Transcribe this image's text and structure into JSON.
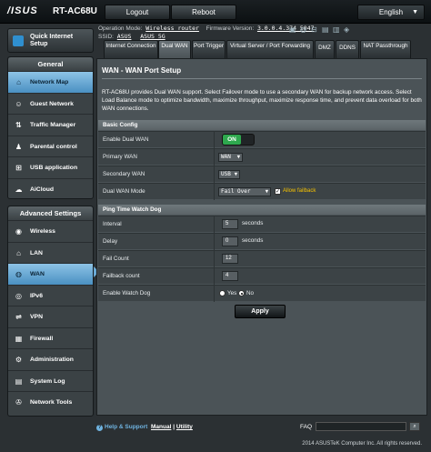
{
  "header": {
    "brand": "/ISUS",
    "model": "RT-AC68U",
    "logout_label": "Logout",
    "reboot_label": "Reboot",
    "language": "English"
  },
  "info": {
    "op_mode_label": "Operation Mode:",
    "op_mode_value": "Wireless router",
    "firmware_label": "Firmware Version:",
    "firmware_value": "3.0.0.4.374_5047",
    "ssid_label": "SSID:",
    "ssid_1": "ASUS",
    "ssid_2": "ASUS_5G"
  },
  "sidebar": {
    "quick_setup": "Quick Internet Setup",
    "general_title": "General",
    "general": [
      {
        "label": "Network Map",
        "icon": "network-map-icon"
      },
      {
        "label": "Guest Network",
        "icon": "guest-network-icon"
      },
      {
        "label": "Traffic Manager",
        "icon": "traffic-manager-icon"
      },
      {
        "label": "Parental control",
        "icon": "parental-control-icon"
      },
      {
        "label": "USB application",
        "icon": "usb-icon"
      },
      {
        "label": "AiCloud",
        "icon": "cloud-icon"
      }
    ],
    "advanced_title": "Advanced Settings",
    "advanced": [
      {
        "label": "Wireless",
        "icon": "wireless-icon"
      },
      {
        "label": "LAN",
        "icon": "lan-icon"
      },
      {
        "label": "WAN",
        "icon": "globe-icon"
      },
      {
        "label": "IPv6",
        "icon": "ipv6-icon"
      },
      {
        "label": "VPN",
        "icon": "vpn-icon"
      },
      {
        "label": "Firewall",
        "icon": "firewall-icon"
      },
      {
        "label": "Administration",
        "icon": "administration-icon"
      },
      {
        "label": "System Log",
        "icon": "system-log-icon"
      },
      {
        "label": "Network Tools",
        "icon": "network-tools-icon"
      }
    ]
  },
  "tabs": [
    {
      "label": "Internet Connection"
    },
    {
      "label": "Dual WAN"
    },
    {
      "label": "Port Trigger"
    },
    {
      "label": "Virtual Server / Port Forwarding"
    },
    {
      "label": "DMZ"
    },
    {
      "label": "DDNS"
    },
    {
      "label": "NAT Passthrough"
    }
  ],
  "main": {
    "title": "WAN - WAN Port Setup",
    "description": "RT-AC68U provides Dual WAN support. Select Failover mode to use a secondary WAN for backup network access. Select Load Balance mode to optimize bandwidth, maximize throughput, maximize response time, and prevent data overload for both WAN connections.",
    "basic_config_title": "Basic Config",
    "enable_dual_wan_label": "Enable Dual WAN",
    "enable_dual_wan_value": "ON",
    "primary_wan_label": "Primary WAN",
    "primary_wan_value": "WAN",
    "secondary_wan_label": "Secondary WAN",
    "secondary_wan_value": "USB",
    "dual_wan_mode_label": "Dual WAN Mode",
    "dual_wan_mode_value": "Fail Over",
    "allow_failback_label": "Allow failback",
    "ping_title": "Ping Time Watch Dog",
    "interval_label": "Interval",
    "interval_value": "5",
    "delay_label": "Delay",
    "delay_value": "0",
    "seconds_unit": "seconds",
    "fail_count_label": "Fail Count",
    "fail_count_value": "12",
    "failback_count_label": "Failback count",
    "failback_count_value": "4",
    "watch_dog_label": "Enable Watch Dog",
    "watch_dog_yes": "Yes",
    "watch_dog_no": "No",
    "apply_label": "Apply"
  },
  "footer": {
    "help_label": "Help & Support",
    "manual_label": "Manual",
    "separator": "|",
    "utility_label": "Utility",
    "faq_label": "FAQ",
    "copyright": "2014 ASUSTeK Computer Inc. All rights reserved."
  }
}
